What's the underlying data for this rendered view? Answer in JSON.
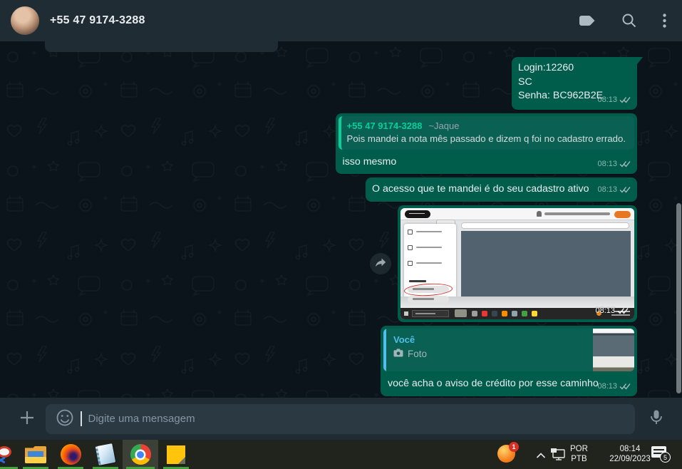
{
  "header": {
    "contact_name": "+55 47 9174-3288",
    "icons": [
      "label-icon",
      "search-icon",
      "menu-kebab-icon"
    ]
  },
  "messages": {
    "m1": {
      "line1": "Login:12260",
      "line2": "SC",
      "line3": "Senha: BC962B2E",
      "time": "08:13"
    },
    "m2": {
      "quote_author": "+55 47 9174-3288",
      "quote_author_suffix": "~Jaque",
      "quote_text": "Pois mandei a nota mês passado e dizem q foi no cadastro errado.",
      "text": "isso mesmo",
      "time": "08:13"
    },
    "m3": {
      "text": "O acesso que te mandei é do seu cadastro ativo",
      "time": "08:13"
    },
    "m4": {
      "time": "08:13",
      "content": "screenshot-image"
    },
    "m5": {
      "quote_author": "Você",
      "quote_media_label": "Foto",
      "text": "você acha o aviso de crédito por esse caminho",
      "time": "08:13"
    }
  },
  "composer": {
    "placeholder": "Digite uma mensagem"
  },
  "taskbar": {
    "language_top": "POR",
    "language_bottom": "PTB",
    "clock_time": "08:14",
    "clock_date": "22/09/2023",
    "notification_count": "5",
    "alert_badge": "1",
    "pinned_apps": [
      "snipping-tool",
      "file-explorer",
      "firefox",
      "notepad",
      "chrome",
      "sticky-notes"
    ]
  },
  "colors": {
    "outgoing_bubble": "#005c4b",
    "accent_green": "#06cf9c",
    "quote_blue": "#53bdeb",
    "header_bg": "#202c33",
    "chat_bg": "#0b141a",
    "taskbar_indicator": "#41a33c"
  }
}
